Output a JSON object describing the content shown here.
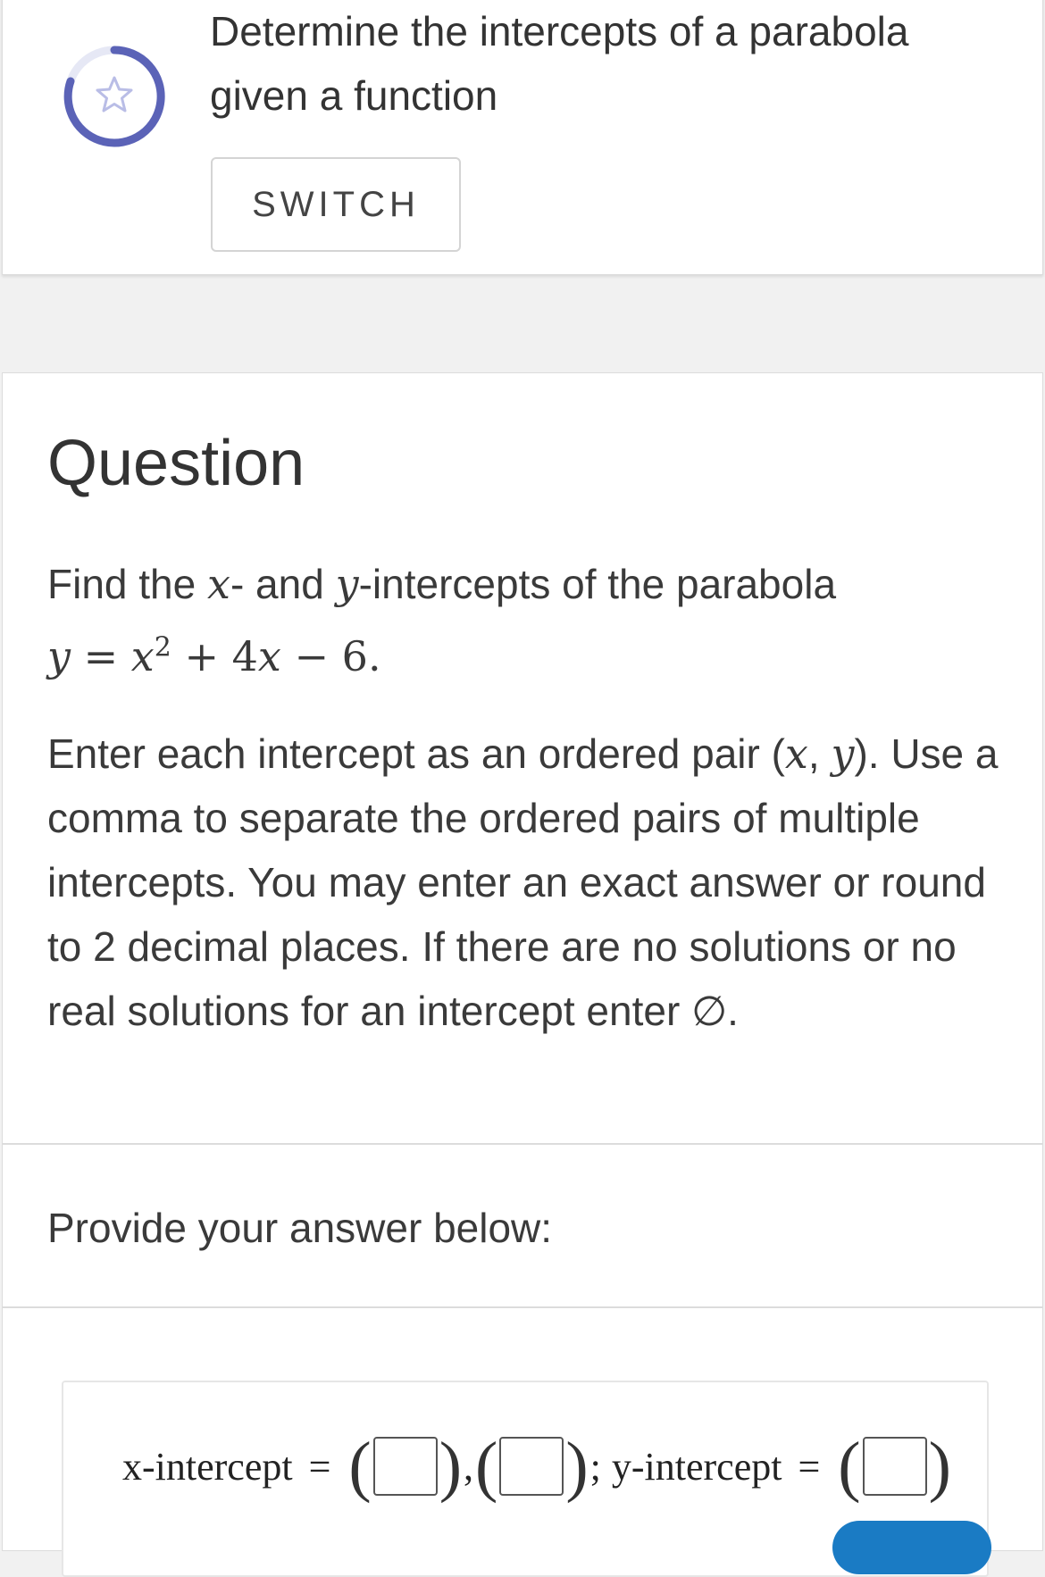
{
  "objective": {
    "title": "Determine the intercepts of a parabola given a function",
    "switch_label": "SWITCH",
    "icon": "star-icon",
    "progress_ring_color": "#5b63b7"
  },
  "question": {
    "heading": "Question",
    "prompt_part1": "Find the ",
    "prompt_x": "x",
    "prompt_part2": "- and ",
    "prompt_y": "y",
    "prompt_part3": "-intercepts of the parabola",
    "equation": {
      "lhs": "y",
      "eq": "=",
      "x": "x",
      "exp": "2",
      "plus": "+",
      "coef": "4",
      "x2": "x",
      "minus": "−",
      "const": "6",
      "dot": "."
    },
    "instructions_part1": "Enter each intercept as an ordered pair (",
    "instructions_x": "x",
    "instructions_comma": ", ",
    "instructions_y": "y",
    "instructions_part2": "). Use a comma to separate the ordered pairs of multiple intercepts. You may enter an exact answer or round to 2 decimal places. If there are no solutions or no real solutions for an intercept enter ",
    "empty_set": "∅",
    "instructions_end": "."
  },
  "answer": {
    "provide_label": "Provide your answer below:",
    "x_intercept_label": "x-intercept",
    "equals": "=",
    "comma": ",",
    "semicolon": ";",
    "y_intercept_label": "y-intercept",
    "open_paren": "(",
    "close_paren": ")"
  },
  "colors": {
    "submit_button": "#1a7bc4"
  }
}
